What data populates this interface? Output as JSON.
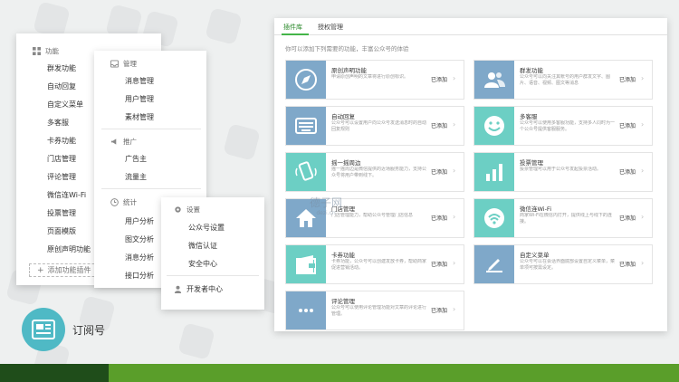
{
  "menu": {
    "function_header": "功能",
    "function_items": [
      "群发功能",
      "自动回复",
      "自定义菜单",
      "多客服",
      "卡券功能",
      "门店管理",
      "评论管理",
      "微信连Wi-Fi",
      "投票管理",
      "页面模版",
      "原创声明功能"
    ],
    "add_plugin": "添加功能插件",
    "manage_header": "管理",
    "manage_items": [
      "消息管理",
      "用户管理",
      "素材管理"
    ],
    "promo_header": "推广",
    "promo_items": [
      "广告主",
      "流量主"
    ],
    "stats_header": "统计",
    "stats_items": [
      "用户分析",
      "图文分析",
      "消息分析",
      "接口分析"
    ],
    "settings_header": "设置",
    "settings_items": [
      "公众号设置",
      "微信认证",
      "安全中心"
    ],
    "developer": "开发者中心"
  },
  "subscription_label": "订阅号",
  "window": {
    "tabs": [
      "插件库",
      "授权管理"
    ],
    "intro": "你可以添加下列需要的功能，丰富公众号的体验",
    "cards": [
      {
        "title": "原创声明功能",
        "desc": "申请原创声明的文章将进行原创标识。",
        "status": "已添加",
        "icon": "compass-icon",
        "color": "#7fa8c9"
      },
      {
        "title": "群发功能",
        "desc": "公众号可以向关注其帐号的用户群发文字、图片、语音、视频、图文等消息",
        "status": "已添加",
        "icon": "users-icon",
        "color": "#7fa8c9"
      },
      {
        "title": "自动回复",
        "desc": "公众号可以设置用户向公众号发送消息时的自动回复规则",
        "status": "已添加",
        "icon": "keyboard-icon",
        "color": "#7fa8c9"
      },
      {
        "title": "多客服",
        "desc": "公众号可以使用多客服功能，支持多人同时为一个公众号提供客服服务。",
        "status": "已添加",
        "icon": "smile-icon",
        "color": "#6ccfc4"
      },
      {
        "title": "摇一摇周边",
        "desc": "摇一摇周边是微信提供的近场服务能力，支持公众号将用户带到线下。",
        "status": "已添加",
        "icon": "phone-shake-icon",
        "color": "#6ccfc4"
      },
      {
        "title": "投票管理",
        "desc": "投票管理可以用于公众号发起投票活动。",
        "status": "已添加",
        "icon": "bar-chart-icon",
        "color": "#6ccfc4"
      },
      {
        "title": "门店管理",
        "desc": "门店管理能力，帮助公众号管理门店信息",
        "status": "已添加",
        "icon": "home-icon",
        "color": "#7fa8c9"
      },
      {
        "title": "微信连Wi-Fi",
        "desc": "商家Wi-Fi在微信内打开，提供线上与线下的连接。",
        "status": "已添加",
        "icon": "wifi-icon",
        "color": "#6ccfc4"
      },
      {
        "title": "卡券功能",
        "desc": "卡券功能，公众号可以创建发放卡券，帮助商家促进营销活动。",
        "status": "已添加",
        "icon": "wallet-icon",
        "color": "#6ccfc4"
      },
      {
        "title": "自定义菜单",
        "desc": "公众号可以在会话界面底部设置自定义菜单，菜单项可按需设定。",
        "status": "已添加",
        "icon": "edit-icon",
        "color": "#7fa8c9"
      },
      {
        "title": "评论管理",
        "desc": "公众号可以使用评论管理功能对文章的评论进行管理。",
        "status": "已添加",
        "icon": "comment-icon",
        "color": "#7fa8c9"
      }
    ]
  },
  "watermark": {
    "cn": "德子网",
    "en": "dezi.cn"
  }
}
